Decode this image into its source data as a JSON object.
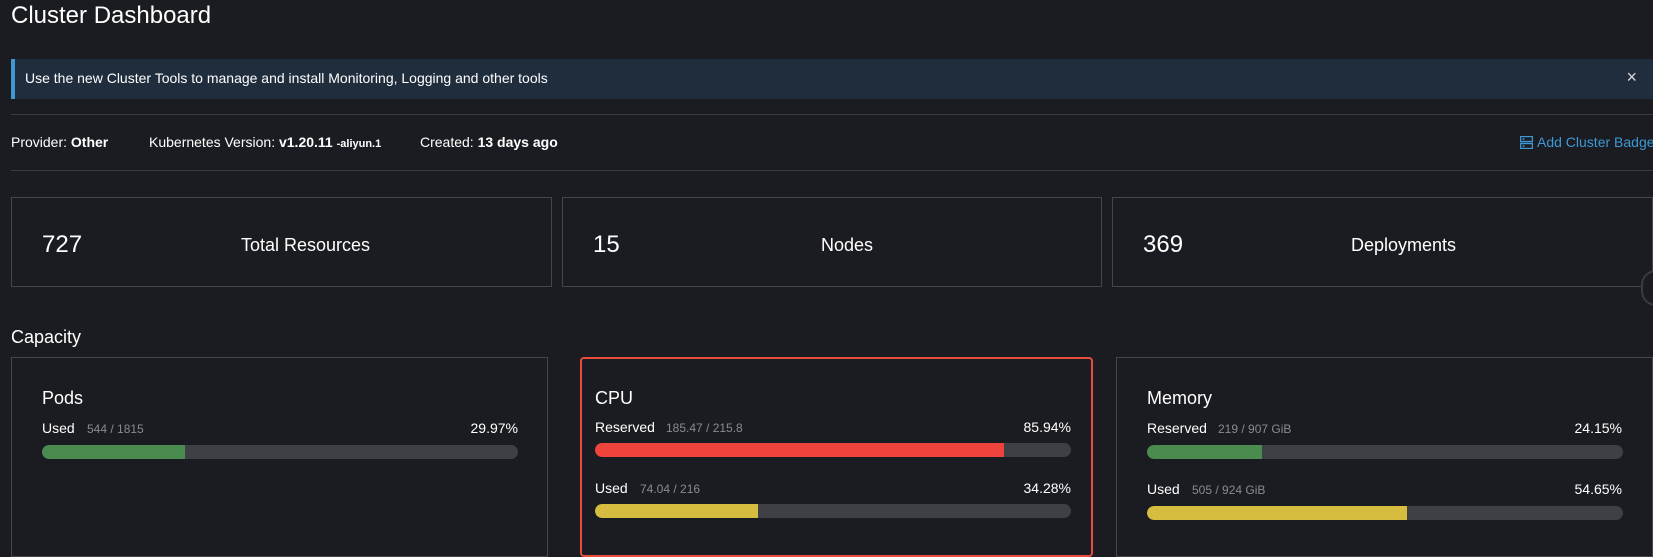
{
  "page": {
    "title": "Cluster Dashboard"
  },
  "banner": {
    "text": "Use the new Cluster Tools to manage and install Monitoring, Logging and other tools",
    "close_icon": "×"
  },
  "meta": {
    "provider_label": "Provider:",
    "provider_value": "Other",
    "k8s_label": "Kubernetes Version:",
    "k8s_value": "v1.20.11",
    "k8s_suffix": "-aliyun.1",
    "created_label": "Created:",
    "created_value": "13 days ago",
    "add_badge": "Add Cluster Badge"
  },
  "stats": [
    {
      "value": "727",
      "label": "Total Resources"
    },
    {
      "value": "15",
      "label": "Nodes"
    },
    {
      "value": "369",
      "label": "Deployments"
    }
  ],
  "capacity": {
    "title": "Capacity",
    "pods": {
      "title": "Pods",
      "rows": [
        {
          "label": "Used",
          "count": "544 / 1815",
          "pct": "29.97%",
          "fraction": 0.2997,
          "color": "#4a8c4f"
        }
      ]
    },
    "cpu": {
      "title": "CPU",
      "rows": [
        {
          "label": "Reserved",
          "count": "185.47 / 215.8",
          "pct": "85.94%",
          "fraction": 0.8594,
          "color": "#f0433c"
        },
        {
          "label": "Used",
          "count": "74.04 / 216",
          "pct": "34.28%",
          "fraction": 0.3428,
          "color": "#d6bd3f"
        }
      ]
    },
    "memory": {
      "title": "Memory",
      "rows": [
        {
          "label": "Reserved",
          "count": "219 / 907 GiB",
          "pct": "24.15%",
          "fraction": 0.2415,
          "color": "#4a8c4f"
        },
        {
          "label": "Used",
          "count": "505 / 924 GiB",
          "pct": "54.65%",
          "fraction": 0.5465,
          "color": "#d6bd3f"
        }
      ]
    }
  },
  "colors": {
    "accent": "#3d98d3",
    "highlight": "#e74c3c"
  }
}
